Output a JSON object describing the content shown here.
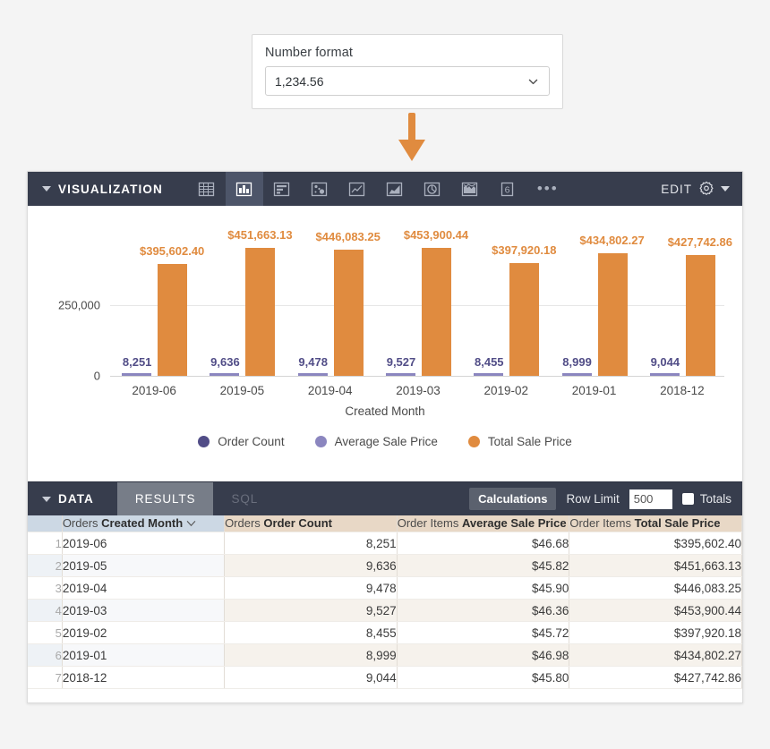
{
  "number_format_panel": {
    "label": "Number format",
    "selected": "1,234.56",
    "chevron_icon": "chevron-down-icon"
  },
  "arrow": {
    "icon": "arrow-down-icon",
    "color": "#e08b3f"
  },
  "visualization_panel": {
    "title": "VISUALIZATION",
    "caret_icon": "caret-down-icon",
    "edit_label": "EDIT",
    "gear_icon": "gear-icon",
    "gear_caret_icon": "caret-down-icon",
    "overflow_icon": "ellipsis-icon",
    "overflow_label": "•••",
    "icons": [
      {
        "name": "table-chart-icon",
        "active": false
      },
      {
        "name": "bar-chart-icon",
        "active": true
      },
      {
        "name": "horizontal-bar-chart-icon",
        "active": false
      },
      {
        "name": "scatter-chart-icon",
        "active": false
      },
      {
        "name": "line-chart-icon",
        "active": false
      },
      {
        "name": "area-chart-icon",
        "active": false
      },
      {
        "name": "pie-chart-icon",
        "active": false
      },
      {
        "name": "map-chart-icon",
        "active": false
      },
      {
        "name": "single-value-icon",
        "active": false,
        "glyph": "6"
      }
    ]
  },
  "chart_data": {
    "type": "bar",
    "title": "",
    "xlabel": "Created Month",
    "ylabel": "",
    "categories": [
      "2019-06",
      "2019-05",
      "2019-04",
      "2019-03",
      "2019-02",
      "2019-01",
      "2018-12"
    ],
    "yticks": [
      "0",
      "250,000"
    ],
    "ytick_values": [
      0,
      250000
    ],
    "ylim": [
      0,
      500000
    ],
    "grid": true,
    "legend_position": "bottom",
    "series": [
      {
        "name": "Order Count",
        "color": "#514d87",
        "legend_color": "#514d87",
        "bar_color": "#8b86bf",
        "values": [
          8251,
          9636,
          9478,
          9527,
          8455,
          8999,
          9044
        ],
        "labels": [
          "8,251",
          "9,636",
          "9,478",
          "9,527",
          "8,455",
          "8,999",
          "9,044"
        ]
      },
      {
        "name": "Average Sale Price",
        "color": "#8b86bf",
        "legend_color": "#8b86bf",
        "bar_color": "#8b86bf",
        "values": [
          46.68,
          45.82,
          45.9,
          46.36,
          45.72,
          46.98,
          45.8
        ],
        "labels": [
          "$46.68",
          "$45.82",
          "$45.90",
          "$46.36",
          "$45.72",
          "$46.98",
          "$45.80"
        ]
      },
      {
        "name": "Total Sale Price",
        "color": "#e08b3f",
        "legend_color": "#e08b3f",
        "bar_color": "#e08b3f",
        "values": [
          395602.4,
          451663.13,
          446083.25,
          453900.44,
          397920.18,
          434802.27,
          427742.86
        ],
        "labels": [
          "$395,602.40",
          "$451,663.13",
          "$446,083.25",
          "$453,900.44",
          "$397,920.18",
          "$434,802.27",
          "$427,742.86"
        ]
      }
    ]
  },
  "data_panel": {
    "title": "DATA",
    "caret_icon": "caret-down-icon",
    "tabs": [
      {
        "label": "RESULTS",
        "active": true
      },
      {
        "label": "SQL",
        "active": false
      }
    ],
    "calculations_label": "Calculations",
    "row_limit_label": "Row Limit",
    "row_limit_value": "500",
    "totals_label": "Totals",
    "totals_checked": false
  },
  "table": {
    "columns": [
      {
        "prefix": "Orders",
        "name": "Created Month",
        "kind": "dimension",
        "sorted": true,
        "sort_icon": "chevron-down-icon"
      },
      {
        "prefix": "Orders",
        "name": "Order Count",
        "kind": "measure",
        "sorted": false
      },
      {
        "prefix": "Order Items",
        "name": "Average Sale Price",
        "kind": "measure",
        "sorted": false
      },
      {
        "prefix": "Order Items",
        "name": "Total Sale Price",
        "kind": "measure",
        "sorted": false
      }
    ],
    "rows": [
      {
        "n": "1",
        "cells": [
          "2019-06",
          "8,251",
          "$46.68",
          "$395,602.40"
        ]
      },
      {
        "n": "2",
        "cells": [
          "2019-05",
          "9,636",
          "$45.82",
          "$451,663.13"
        ]
      },
      {
        "n": "3",
        "cells": [
          "2019-04",
          "9,478",
          "$45.90",
          "$446,083.25"
        ]
      },
      {
        "n": "4",
        "cells": [
          "2019-03",
          "9,527",
          "$46.36",
          "$453,900.44"
        ]
      },
      {
        "n": "5",
        "cells": [
          "2019-02",
          "8,455",
          "$45.72",
          "$397,920.18"
        ]
      },
      {
        "n": "6",
        "cells": [
          "2019-01",
          "8,999",
          "$46.98",
          "$434,802.27"
        ]
      },
      {
        "n": "7",
        "cells": [
          "2018-12",
          "9,044",
          "$45.80",
          "$427,742.86"
        ]
      }
    ]
  },
  "colors": {
    "accent_orange": "#e08b3f",
    "dark_purple": "#514d87",
    "light_purple": "#8b86bf",
    "panel_dark": "#373d4d",
    "dimension_header": "#ccd8e4",
    "measure_header": "#e8d8c6"
  }
}
